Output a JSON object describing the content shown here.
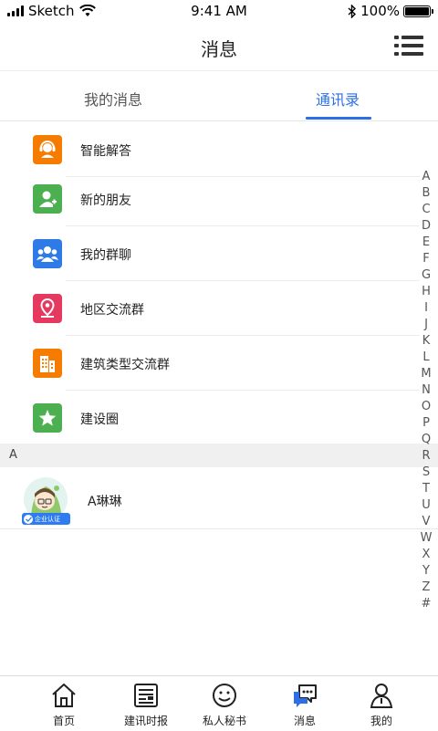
{
  "status_bar": {
    "carrier": "Sketch",
    "time": "9:41 AM",
    "battery": "100%"
  },
  "header": {
    "title": "消息"
  },
  "tabs": [
    {
      "label": "我的消息",
      "active": false
    },
    {
      "label": "通讯录",
      "active": true
    }
  ],
  "menu_items": [
    {
      "label": "智能解答",
      "icon": "customer-service-icon",
      "color": "#f57c00"
    },
    {
      "label": "新的朋友",
      "icon": "add-friend-icon",
      "color": "#4caf50"
    },
    {
      "label": "我的群聊",
      "icon": "group-icon",
      "color": "#2e7be8"
    },
    {
      "label": "地区交流群",
      "icon": "location-icon",
      "color": "#e53960"
    },
    {
      "label": "建筑类型交流群",
      "icon": "building-icon",
      "color": "#f57c00"
    },
    {
      "label": "建设圈",
      "icon": "star-icon",
      "color": "#4caf50"
    }
  ],
  "section": {
    "letter": "A"
  },
  "contact": {
    "name": "A琳琳",
    "badge": "企业认证"
  },
  "alphabet_index": [
    "A",
    "B",
    "C",
    "D",
    "E",
    "F",
    "G",
    "H",
    "I",
    "J",
    "K",
    "L",
    "M",
    "N",
    "O",
    "P",
    "Q",
    "R",
    "S",
    "T",
    "U",
    "V",
    "W",
    "X",
    "Y",
    "Z",
    "#"
  ],
  "bottom_tabs": [
    {
      "label": "首页",
      "icon": "home-icon"
    },
    {
      "label": "建讯时报",
      "icon": "newspaper-icon"
    },
    {
      "label": "私人秘书",
      "icon": "smile-icon"
    },
    {
      "label": "消息",
      "icon": "message-icon",
      "active": true
    },
    {
      "label": "我的",
      "icon": "profile-icon"
    }
  ],
  "colors": {
    "accent": "#2e6fe6"
  }
}
